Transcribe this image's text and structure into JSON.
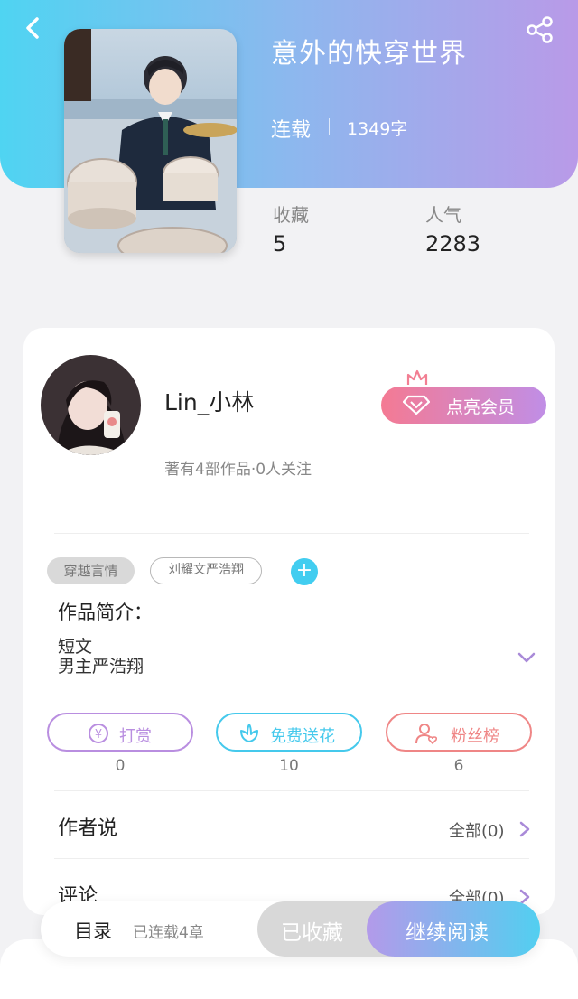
{
  "book": {
    "title": "意外的快穿世界",
    "status": "连载",
    "word_count": "1349字",
    "cover_icon": "cover-image"
  },
  "stats": {
    "favorites_label": "收藏",
    "favorites_value": "5",
    "popularity_label": "人气",
    "popularity_value": "2283"
  },
  "author": {
    "name": "Lin_小林",
    "meta": "著有4部作品·0人关注",
    "vip_label": "点亮会员"
  },
  "tags": [
    "穿越言情",
    "刘耀文严浩翔"
  ],
  "intro": {
    "title": "作品简介：",
    "lines": [
      "短文",
      "男主严浩翔"
    ]
  },
  "actions": [
    {
      "label": "打赏",
      "count": "0",
      "color": "#b98ee0",
      "icon": "yen-icon"
    },
    {
      "label": "免费送花",
      "count": "10",
      "color": "#45c9ec",
      "icon": "flower-icon"
    },
    {
      "label": "粉丝榜",
      "count": "6",
      "color": "#ef8686",
      "icon": "fan-user-icon"
    }
  ],
  "sections": {
    "author_says": {
      "title": "作者说",
      "link": "全部(0)"
    },
    "comments": {
      "title": "评论",
      "link": "全部(0)"
    }
  },
  "bottom_bar": {
    "toc_label": "目录",
    "toc_meta": "已连载4章",
    "collected_label": "已收藏",
    "read_label": "继续阅读"
  },
  "colors": {
    "header_start": "#4fd4f2",
    "header_end": "#b99ae8",
    "accent_purple": "#b98ee0",
    "accent_cyan": "#45c9ec",
    "accent_red": "#ef8686"
  }
}
